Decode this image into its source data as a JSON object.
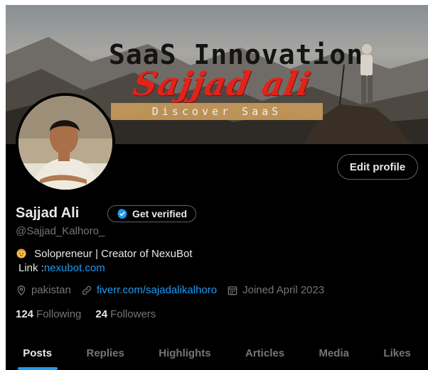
{
  "banner": {
    "title": "SaaS Innovation",
    "script": "Sajjad ali",
    "strip": "Discover SaaS"
  },
  "profile": {
    "edit_label": "Edit profile",
    "name": "Sajjad Ali",
    "verify_label": "Get verified",
    "handle": "@Sajjad_Kalhoro_",
    "bio_line1": "Solopreneur | Creator of NexuBot",
    "bio_link_prefix": "Link :",
    "bio_link": "nexubot.com",
    "location": "pakistan",
    "website": "fiverr.com/sajadalikalhoro",
    "joined": "Joined April 2023",
    "following_count": "124",
    "following_label": "Following",
    "followers_count": "24",
    "followers_label": "Followers"
  },
  "tabs": [
    {
      "label": "Posts",
      "active": true
    },
    {
      "label": "Replies"
    },
    {
      "label": "Highlights"
    },
    {
      "label": "Articles"
    },
    {
      "label": "Media"
    },
    {
      "label": "Likes"
    }
  ],
  "colors": {
    "background": "#000000",
    "text": "#e7e9ea",
    "muted": "#71767b",
    "accent": "#1d9bf0",
    "border": "#536471"
  },
  "icons": [
    "verified-badge-icon",
    "location-pin-icon",
    "link-icon",
    "calendar-icon",
    "person-emoji-icon"
  ]
}
